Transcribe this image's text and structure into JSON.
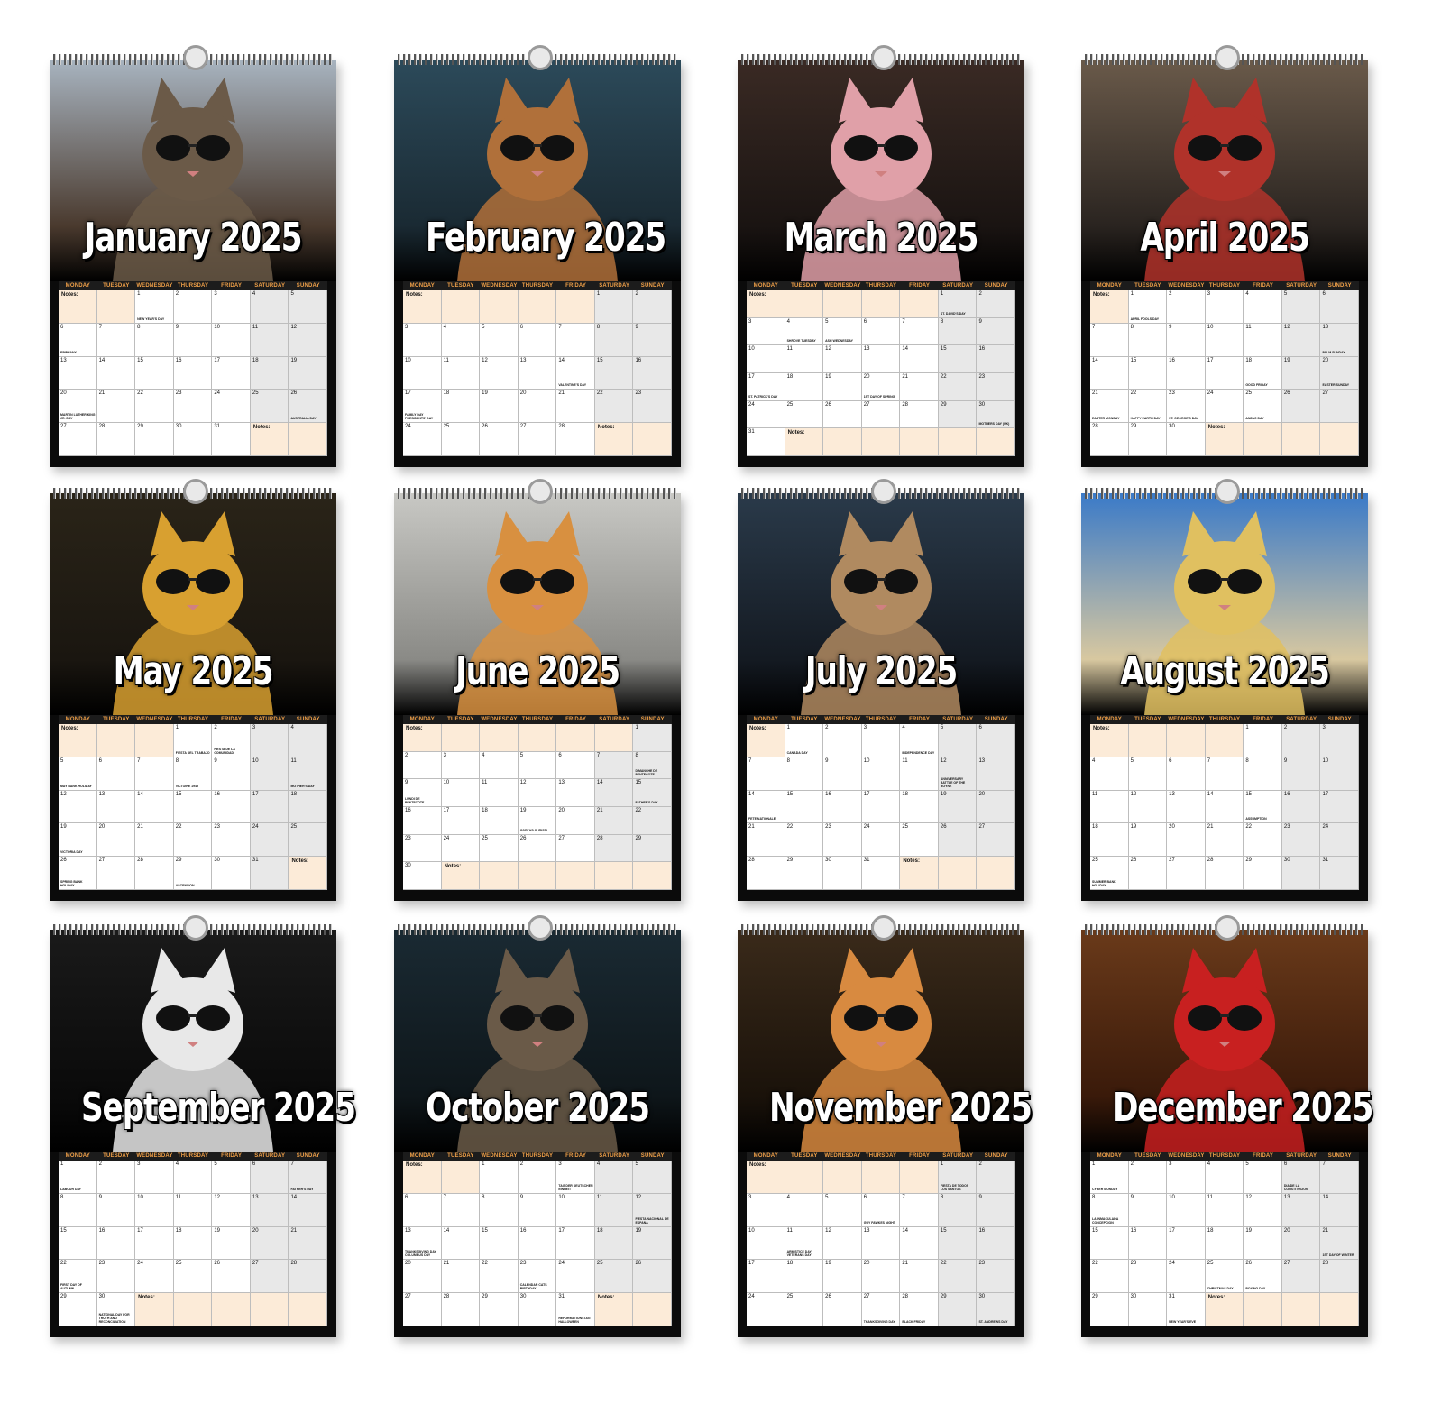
{
  "weekday_headers": [
    "MONDAY",
    "TUESDAY",
    "WEDNESDAY",
    "THURSDAY",
    "FRIDAY",
    "SATURDAY",
    "SUNDAY"
  ],
  "notes_label": "Notes:",
  "months": [
    {
      "title": "January 2025",
      "start": 2,
      "days": 31,
      "colors": [
        "#a8b4c0",
        "#4a3a2e",
        "#6b5a48"
      ],
      "holidays": {
        "1": "NEW YEAR'S DAY",
        "6": "EPIPHANY",
        "20": "MARTIN LUTHER KING JR. DAY",
        "26": "AUSTRALIA DAY"
      }
    },
    {
      "title": "February 2025",
      "start": 5,
      "days": 28,
      "colors": [
        "#2c4a5a",
        "#1a2a33",
        "#b0703a"
      ],
      "holidays": {
        "14": "VALENTINE'S DAY",
        "17": "FAMILY DAY PRESIDENTS' DAY"
      }
    },
    {
      "title": "March 2025",
      "start": 5,
      "days": 31,
      "colors": [
        "#3a2a24",
        "#1a1412",
        "#e0a0a8"
      ],
      "holidays": {
        "1": "ST. DAVID'S DAY",
        "4": "SHROVE TUESDAY",
        "5": "ASH WEDNESDAY",
        "17": "ST. PATRICK'S DAY",
        "20": "1ST DAY OF SPRING",
        "30": "MOTHERS DAY (UK)"
      }
    },
    {
      "title": "April 2025",
      "start": 1,
      "days": 30,
      "colors": [
        "#6a5a4a",
        "#2a2420",
        "#b0322a"
      ],
      "holidays": {
        "1": "APRIL FOOLS DAY",
        "13": "PALM SUNDAY",
        "18": "GOOD FRIDAY",
        "20": "EASTER SUNDAY",
        "21": "EASTER MONDAY",
        "22": "HAPPY EARTH DAY",
        "23": "ST. GEORGE'S DAY",
        "25": "ANZAC DAY"
      }
    },
    {
      "title": "May 2025",
      "start": 3,
      "days": 31,
      "colors": [
        "#2a2418",
        "#1a1610",
        "#d8a030"
      ],
      "holidays": {
        "1": "FIESTA DEL TRABAJO",
        "2": "FIESTA DE LA COMUNIDAD",
        "5": "MAY BANK HOLIDAY",
        "8": "VICTOIRE 1945",
        "11": "MOTHER'S DAY",
        "19": "VICTORIA DAY",
        "26": "SPRING BANK HOLIDAY",
        "29": "ASCENSION"
      }
    },
    {
      "title": "June 2025",
      "start": 6,
      "days": 30,
      "colors": [
        "#c8c8c4",
        "#8a8a86",
        "#d89040"
      ],
      "holidays": {
        "8": "DIMANCHE DE PENTECOTE",
        "9": "LUNDI DE PENTECOTE",
        "15": "FATHER'S DAY",
        "19": "CORPUS CHRISTI"
      }
    },
    {
      "title": "July 2025",
      "start": 1,
      "days": 31,
      "colors": [
        "#2a3a4a",
        "#141a22",
        "#b08a60"
      ],
      "holidays": {
        "1": "CANADA DAY",
        "4": "INDEPENDENCE DAY",
        "12": "ANNIVERSARY BATTLE OF THE BOYNE",
        "14": "FETE NATIONALE"
      }
    },
    {
      "title": "August 2025",
      "start": 4,
      "days": 31,
      "colors": [
        "#3a7ac8",
        "#d8c8a0",
        "#e0c060"
      ],
      "holidays": {
        "15": "ASSUMPTION",
        "25": "SUMMER BANK HOLIDAY"
      }
    },
    {
      "title": "September 2025",
      "start": 0,
      "days": 30,
      "colors": [
        "#1a1a1a",
        "#0a0a0a",
        "#e8e8e8"
      ],
      "holidays": {
        "1": "LABOUR DAY",
        "7": "FATHER'S DAY",
        "22": "FIRST DAY OF AUTUMN",
        "30": "NATIONAL DAY FOR TRUTH AND RECONCILIATION"
      }
    },
    {
      "title": "October 2025",
      "start": 2,
      "days": 31,
      "colors": [
        "#1a2a33",
        "#0e161a",
        "#6a5a48"
      ],
      "holidays": {
        "3": "TAG DER DEUTSCHEN EINHEIT",
        "12": "FIESTA NACIONAL DE ESPANA",
        "13": "THANKSGIVING DAY COLUMBUS DAY",
        "23": "CALENDAR CATS BIRTHDAY",
        "31": "REFORMATIONSTAG HALLOWEEN"
      }
    },
    {
      "title": "November 2025",
      "start": 5,
      "days": 30,
      "colors": [
        "#3a2a1a",
        "#1a120a",
        "#d88a40"
      ],
      "holidays": {
        "1": "FIESTA DE TODOS LOS SANTOS",
        "6": "GUY FAWKES NIGHT",
        "11": "ARMISTICE DAY VETERANS DAY",
        "27": "THANKSGIVING DAY",
        "28": "BLACK FRIDAY",
        "30": "ST. ANDREWS DAY"
      }
    },
    {
      "title": "December 2025",
      "start": 0,
      "days": 31,
      "colors": [
        "#6a3a1a",
        "#3a1a0a",
        "#c82020"
      ],
      "holidays": {
        "1": "CYBER MONDAY",
        "6": "DIA DE LA CONSTITUCION",
        "8": "LA INMACULADA CONCEPCION",
        "21": "1ST DAY OF WINTER",
        "25": "CHRISTMAS DAY",
        "26": "BOXING DAY",
        "31": "NEW YEAR'S EVE"
      }
    }
  ]
}
